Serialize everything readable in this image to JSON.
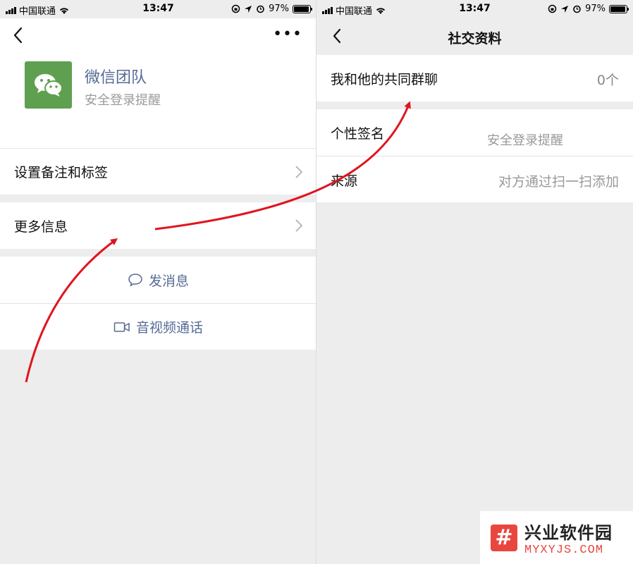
{
  "status_bar": {
    "carrier": "中国联通",
    "time": "13:47",
    "battery_percent": "97%",
    "battery_level": 0.97
  },
  "left_screen": {
    "contact": {
      "name": "微信团队",
      "subtitle": "安全登录提醒",
      "avatar_color": "#5ea04f"
    },
    "more_menu": "•••",
    "rows": [
      {
        "label": "设置备注和标签"
      },
      {
        "label": "更多信息"
      }
    ],
    "actions": [
      {
        "label": "发消息",
        "icon": "chat-bubble-icon"
      },
      {
        "label": "音视频通话",
        "icon": "video-camera-icon"
      }
    ]
  },
  "right_screen": {
    "title": "社交资料",
    "common_groups": {
      "label": "我和他的共同群聊",
      "value": "0个"
    },
    "signature": {
      "label": "个性签名",
      "value": "安全登录提醒"
    },
    "source": {
      "label": "来源",
      "value": "对方通过扫一扫添加"
    }
  },
  "watermark": {
    "logo_char": "#",
    "title": "兴业软件园",
    "url": "MYXYJS.COM"
  },
  "colors": {
    "link_blue": "#576b95",
    "arrow_red": "#e0141e",
    "wechat_green": "#5ea04f",
    "watermark_red": "#e8473f"
  }
}
